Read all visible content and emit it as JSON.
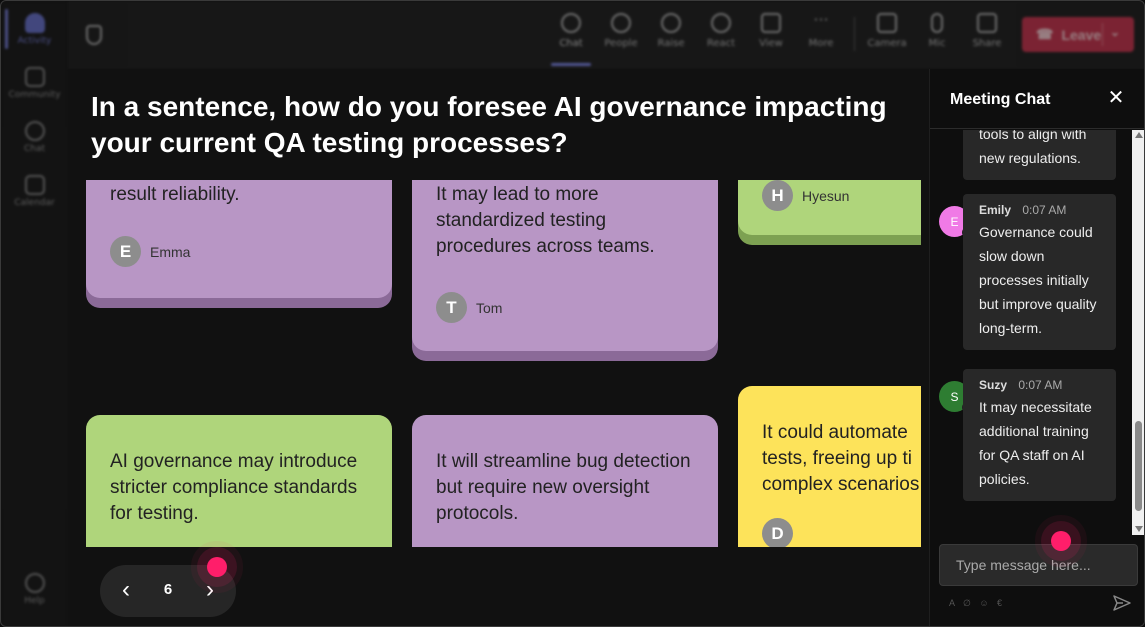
{
  "rail": {
    "items": [
      {
        "label": "Activity",
        "active": true
      },
      {
        "label": "Community",
        "active": false
      },
      {
        "label": "Chat",
        "active": false
      },
      {
        "label": "Calendar",
        "active": false
      },
      {
        "label": "Help",
        "active": false
      }
    ]
  },
  "toolbar": {
    "buttons": [
      {
        "label": "Chat",
        "icon": "chat-icon",
        "active": true
      },
      {
        "label": "People",
        "icon": "people-icon"
      },
      {
        "label": "Raise",
        "icon": "raise-hand-icon"
      },
      {
        "label": "React",
        "icon": "react-icon"
      },
      {
        "label": "View",
        "icon": "view-icon"
      },
      {
        "label": "More",
        "icon": "more-icon"
      },
      {
        "label": "Camera",
        "icon": "camera-icon"
      },
      {
        "label": "Mic",
        "icon": "mic-icon"
      },
      {
        "label": "Share",
        "icon": "share-icon"
      }
    ],
    "leave_label": "Leave",
    "leave_color": "#c4314b",
    "accent_color": "#7b83e6"
  },
  "stage": {
    "question": "In a sentence, how do you foresee AI governance impacting your current QA testing processes?",
    "cards": [
      {
        "text": "result reliability.",
        "author": "Emma",
        "initial": "E",
        "color": "purple"
      },
      {
        "text": "It may lead to more standardized testing procedures across teams.",
        "author": "Tom",
        "initial": "T",
        "color": "purple"
      },
      {
        "text": "",
        "author": "Hyesun",
        "initial": "H",
        "color": "green"
      },
      {
        "text": "AI governance may introduce stricter compliance standards for testing.",
        "author": "",
        "initial": "",
        "color": "green"
      },
      {
        "text": "It will streamline bug detection but require new oversight protocols.",
        "author": "",
        "initial": "",
        "color": "purple"
      },
      {
        "text": "It could automate tests, freeing up ti complex scenarios",
        "author": "",
        "initial": "D",
        "color": "yellow"
      }
    ],
    "card_colors": {
      "purple": "#b896c5",
      "green": "#afd57b",
      "yellow": "#fde35a"
    },
    "pager": {
      "page": "6",
      "prev_icon": "chevron-left-icon",
      "next_icon": "chevron-right-icon"
    }
  },
  "chat": {
    "title": "Meeting Chat",
    "messages": [
      {
        "name": "",
        "time": "",
        "text": "tools to align with new regulations.",
        "initial": "",
        "avatar_color": ""
      },
      {
        "name": "Emily",
        "time": "0:07 AM",
        "text": "Governance could slow down processes initially but improve quality long-term.",
        "initial": "E",
        "avatar_color": "#f07ae6"
      },
      {
        "name": "Suzy",
        "time": "0:07 AM",
        "text": "It may necessitate additional training for QA staff on AI policies.",
        "initial": "S",
        "avatar_color": "#2e7d32"
      }
    ],
    "input_placeholder": "Type message here...",
    "send_icon": "send-icon"
  }
}
